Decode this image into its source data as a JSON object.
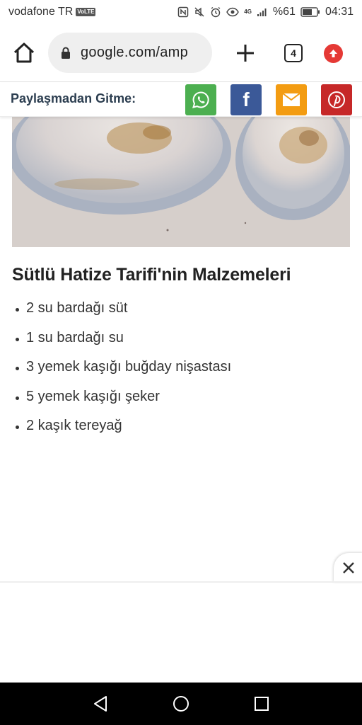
{
  "status_bar": {
    "carrier": "vodafone TR",
    "volte": "VoLTE",
    "net": "4G",
    "battery": "%61",
    "time": "04:31"
  },
  "toolbar": {
    "url": "google.com/amp",
    "tab_count": "4",
    "icons": [
      "home-icon",
      "lock-icon",
      "plus-icon",
      "tabs-icon",
      "update-icon"
    ]
  },
  "share": {
    "label": "Paylaşmadan Gitme:",
    "buttons": [
      {
        "name": "whatsapp",
        "color": "#4caf50"
      },
      {
        "name": "facebook",
        "color": "#3b5998",
        "glyph": "f"
      },
      {
        "name": "email",
        "color": "#f39c12"
      },
      {
        "name": "pinterest",
        "color": "#c62828"
      }
    ]
  },
  "recipe": {
    "title": "Sütlü Hatize Tarifi'nin Malzemeleri",
    "ingredients": [
      "2 su bardağı süt",
      "1 su bardağı su",
      "3 yemek kaşığı buğday nişastası",
      "5 yemek kaşığı şeker",
      "2 kaşık tereyağ"
    ]
  },
  "ad": {
    "close_icon": "close-icon"
  },
  "navbar": {
    "icons": [
      "back-icon",
      "home-circle-icon",
      "recents-icon"
    ]
  }
}
